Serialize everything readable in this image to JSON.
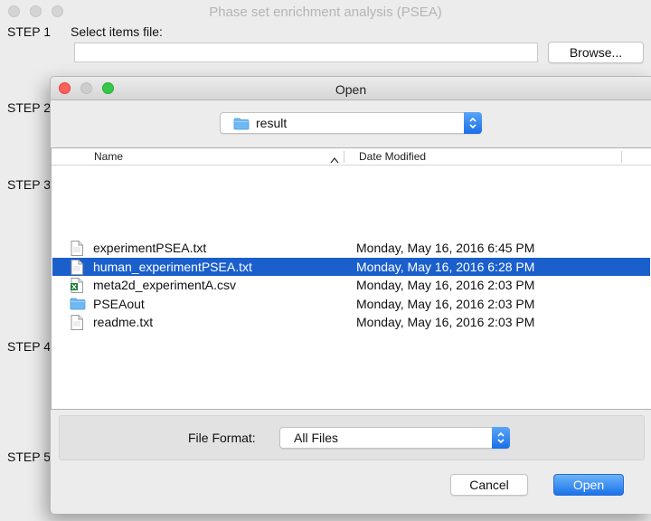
{
  "main_window": {
    "title": "Phase set enrichment analysis (PSEA)",
    "steps": [
      {
        "label": "STEP 1"
      },
      {
        "label": "STEP 2"
      },
      {
        "label": "STEP 3"
      },
      {
        "label": "STEP 4"
      },
      {
        "label": "STEP 5"
      }
    ],
    "select_items_label": "Select items file:",
    "items_file_value": "",
    "browse_label": "Browse..."
  },
  "dialog": {
    "title": "Open",
    "location": "result",
    "columns": {
      "name": "Name",
      "date": "Date Modified"
    },
    "files": [
      {
        "name": "experimentPSEA.txt",
        "date": "Monday, May 16, 2016 6:45 PM",
        "icon": "text-file-icon",
        "selected": false
      },
      {
        "name": "human_experimentPSEA.txt",
        "date": "Monday, May 16, 2016 6:28 PM",
        "icon": "text-file-icon",
        "selected": true
      },
      {
        "name": "meta2d_experimentA.csv",
        "date": "Monday, May 16, 2016 2:03 PM",
        "icon": "excel-file-icon",
        "selected": false
      },
      {
        "name": "PSEAout",
        "date": "Monday, May 16, 2016 2:03 PM",
        "icon": "folder-icon",
        "selected": false
      },
      {
        "name": "readme.txt",
        "date": "Monday, May 16, 2016 2:03 PM",
        "icon": "text-file-icon",
        "selected": false
      }
    ],
    "file_format_label": "File Format:",
    "file_format_value": "All Files",
    "cancel_label": "Cancel",
    "open_label": "Open"
  },
  "colors": {
    "selection": "#1a5fcc",
    "accent": "#1a73ea",
    "close": "#fc605c",
    "minimize": "#c8c8c8",
    "zoom": "#34c84a"
  }
}
